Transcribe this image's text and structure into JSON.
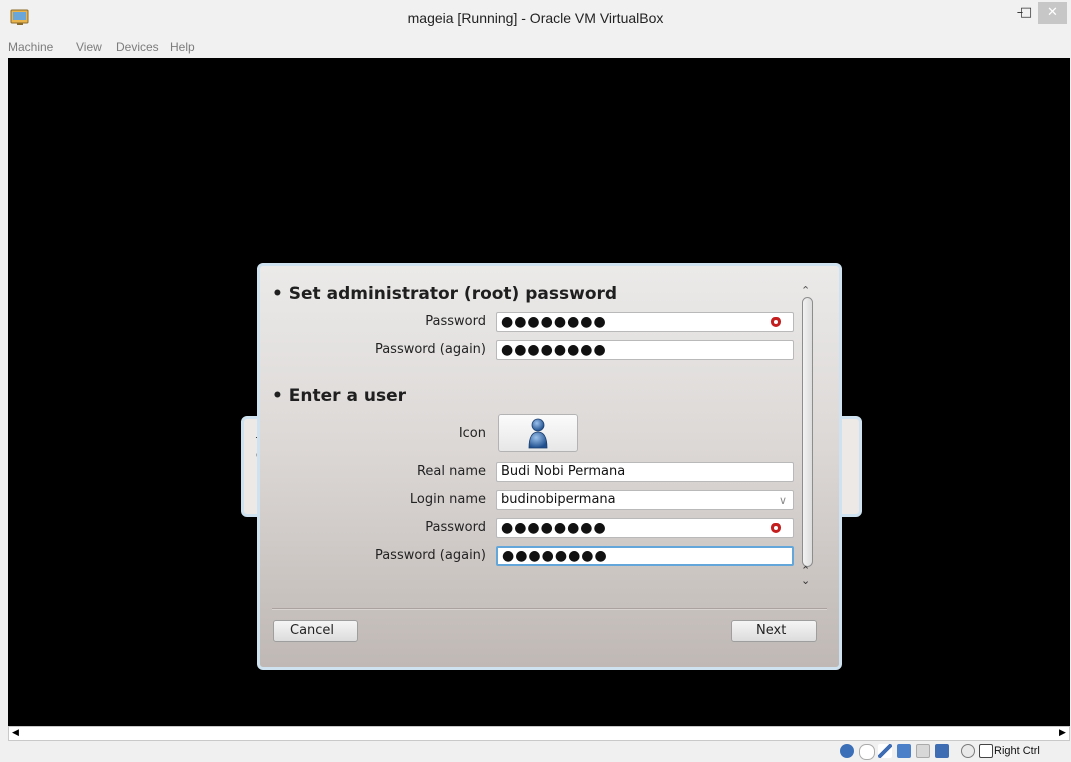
{
  "window": {
    "title": "mageia [Running] - Oracle VM VirtualBox",
    "minimize_glyph": "–",
    "maximize_glyph": "□",
    "close_glyph": "✕"
  },
  "menu": [
    "Machine",
    "View",
    "Devices",
    "Help"
  ],
  "background_dialog": {
    "text_line_1": "T",
    "text_line_2": "C"
  },
  "installer": {
    "root_section": {
      "title": "• Set administrator (root) password",
      "password_label": "Password",
      "password_value": "●●●●●●●●",
      "password_again_label": "Password (again)",
      "password_again_value": "●●●●●●●●"
    },
    "user_section": {
      "title": "• Enter a user",
      "icon_label": "Icon",
      "real_name_label": "Real name",
      "real_name_value": "Budi Nobi Permana",
      "login_name_label": "Login name",
      "login_name_value": "budinobipermana",
      "password_label": "Password",
      "password_value": "●●●●●●●●",
      "password_again_label": "Password (again)",
      "password_again_value": "●●●●●●●●"
    },
    "cancel_label": "Cancel",
    "next_label": "Next"
  },
  "statusbar": {
    "host_key": "Right Ctrl"
  },
  "colors": {
    "focus_border": "#63a7da",
    "strength_weak": "#c41e1e",
    "dialog_border": "#cfe2ef"
  }
}
